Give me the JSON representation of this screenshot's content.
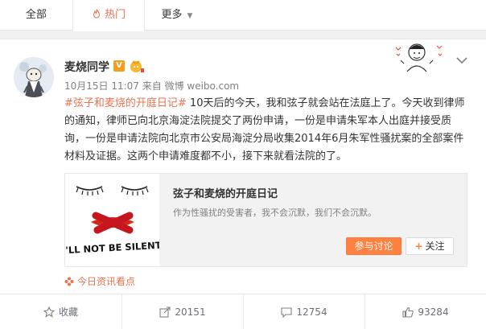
{
  "tabs": {
    "all": "全部",
    "hot": "热门",
    "more": "更多"
  },
  "post": {
    "username": "麦烧同学",
    "vip_letter": "V",
    "meta": "10月15日 11:07 来自 微博 weibo.com",
    "hashtag": "#弦子和麦烧的开庭日记#",
    "body": " 10天后的今天，我和弦子就会站在法庭上了。今天收到律师的通知，律师已向北京海淀法院提交了两份申请，一份是申请朱军本人出庭并接受质询，一份是申请法院向北京市公安局海淀分局收集2014年6月朱军性骚扰案的全部案件材料及证据。这两个申请难度都不小，接下来就看法院的了。"
  },
  "share_card": {
    "title": "弦子和麦烧的开庭日记",
    "description": "作为性骚扰的受害者，我不会沉默，我们不会沉默。",
    "image_text": "I'LL NOT BE SILENT",
    "join_label": "参与讨论",
    "follow_label": "关注",
    "follow_plus": "+"
  },
  "source": "今日资讯看点",
  "actions": {
    "favorite": "收藏",
    "forward": "20151",
    "comment": "12754",
    "like": "93284"
  },
  "colors": {
    "accent": "#eb7350",
    "button": "#ff8140",
    "text": "#333333",
    "muted": "#808080"
  }
}
